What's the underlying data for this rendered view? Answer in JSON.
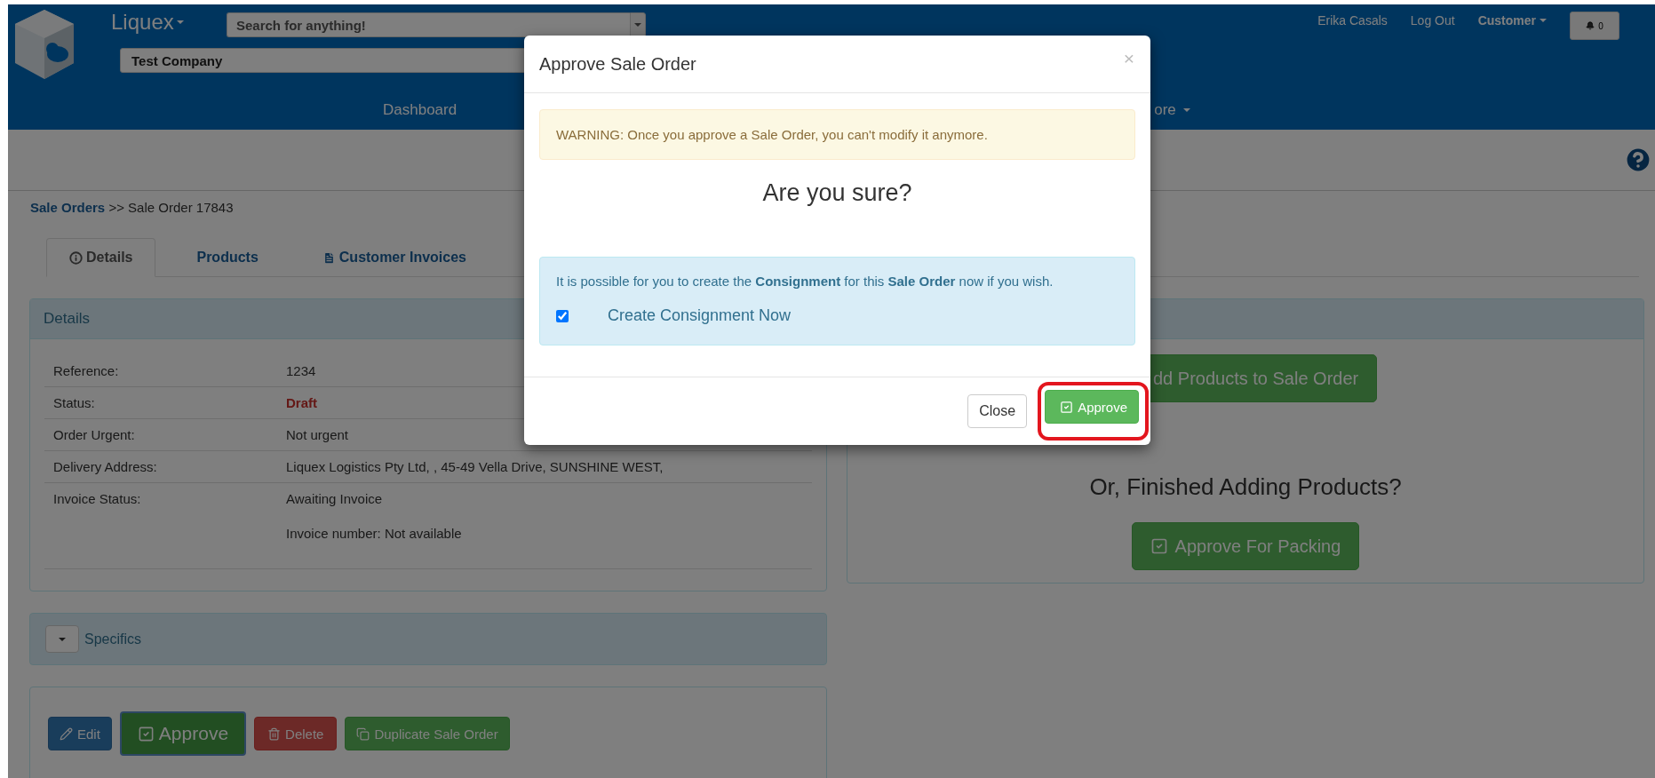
{
  "header": {
    "brand": "Liquex",
    "search": {
      "placeholder": "Search for anything!"
    },
    "company": {
      "value": "Test Company"
    },
    "user": "Erika Casals",
    "logout": "Log Out",
    "role_menu": "Customer",
    "notifications": "0",
    "nav": [
      {
        "label": "Dashboard",
        "dropdown": false
      },
      {
        "label": "ore",
        "dropdown": true
      }
    ]
  },
  "breadcrumb": {
    "link": "Sale Orders",
    "separator": ">>",
    "current": "Sale Order 17843"
  },
  "tabs": [
    {
      "label": "Details",
      "selected": true
    },
    {
      "label": "Products",
      "selected": false
    },
    {
      "label": "Customer Invoices",
      "selected": false
    }
  ],
  "details_panel": {
    "title": "Details",
    "rows": [
      {
        "label": "Reference:",
        "value": "1234",
        "kind": "plain"
      },
      {
        "label": "Status:",
        "value": "Draft",
        "kind": "alert"
      },
      {
        "label": "Order Urgent:",
        "value": "Not urgent",
        "kind": "plain"
      },
      {
        "label": "Delivery Address:",
        "value": "Liquex Logistics Pty Ltd, , 45-49 Vella Drive, SUNSHINE WEST,",
        "kind": "plain"
      },
      {
        "label": "Invoice Status:",
        "value": "Awaiting Invoice",
        "kind": "plain",
        "note": "Invoice number: Not available"
      }
    ]
  },
  "specifics": {
    "title": "Specifics"
  },
  "actions": [
    {
      "label": "Edit",
      "kind": "primary"
    },
    {
      "label": "Approve",
      "kind": "success-large"
    },
    {
      "label": "Delete",
      "kind": "danger"
    },
    {
      "label": "Duplicate Sale Order",
      "kind": "success"
    }
  ],
  "products_panel": {
    "add_button": "dd Products to Sale Order",
    "prompt": "Or, Finished Adding Products?",
    "approve_button": "Approve For Packing"
  },
  "modal": {
    "title": "Approve Sale Order",
    "close": "×",
    "warning": "WARNING: Once you approve a Sale Order, you can't modify it anymore.",
    "question": "Are you sure?",
    "info": "It is possible for you to create the **Consignment** for this **Sale Order** now if you wish.",
    "checkbox": {
      "label": "Create Consignment Now",
      "checked": true
    },
    "buttons": [
      {
        "label": "Close",
        "kind": "default",
        "highlighted": false
      },
      {
        "label": "Approve",
        "kind": "success",
        "highlighted": true
      }
    ]
  }
}
